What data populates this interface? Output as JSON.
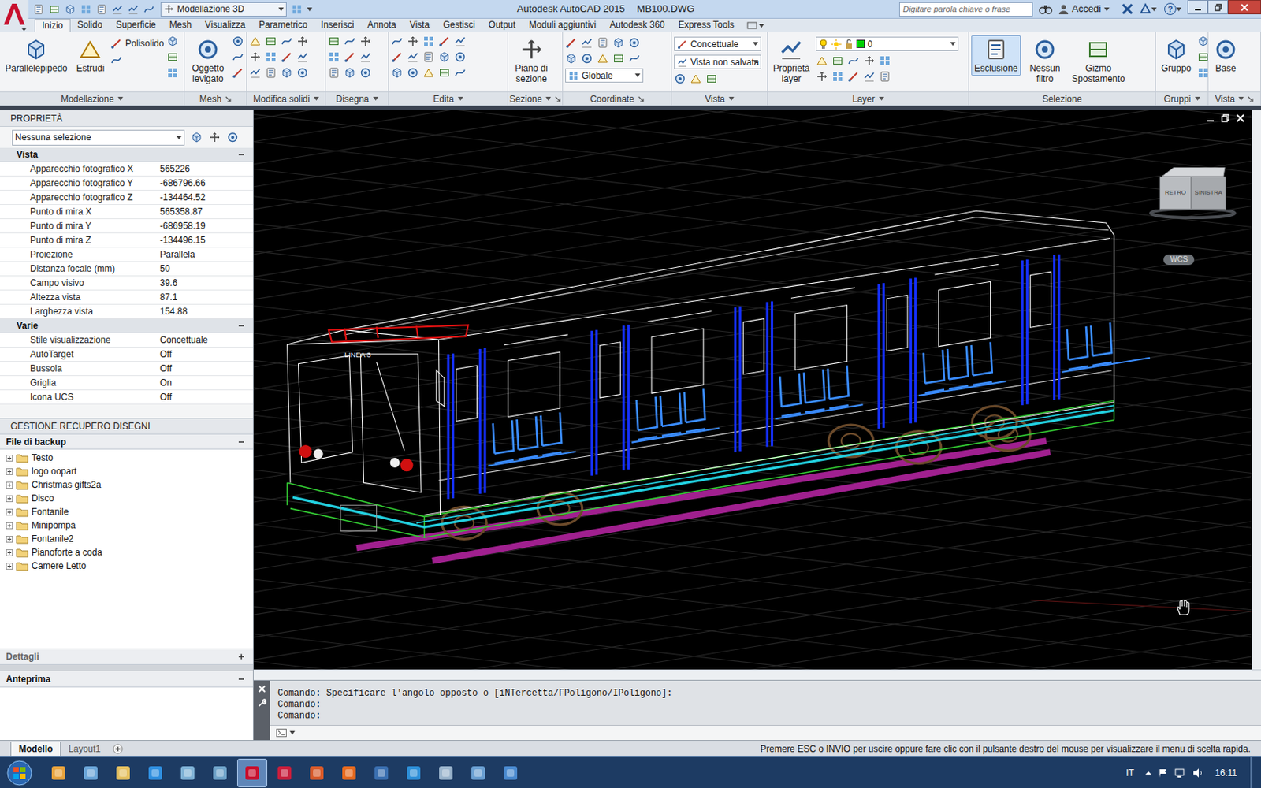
{
  "window": {
    "app": "Autodesk AutoCAD 2015",
    "file": "MB100.DWG"
  },
  "workspace": "Modellazione 3D",
  "search": {
    "placeholder": "Digitare parola chiave o frase"
  },
  "account": "Accedi",
  "help": "?",
  "ribbon_tabs": [
    {
      "label": "Inizio",
      "selected": true
    },
    {
      "label": "Solido",
      "selected": false
    },
    {
      "label": "Superficie",
      "selected": false
    },
    {
      "label": "Mesh",
      "selected": false
    },
    {
      "label": "Visualizza",
      "selected": false
    },
    {
      "label": "Parametrico",
      "selected": false
    },
    {
      "label": "Inserisci",
      "selected": false
    },
    {
      "label": "Annota",
      "selected": false
    },
    {
      "label": "Vista",
      "selected": false
    },
    {
      "label": "Gestisci",
      "selected": false
    },
    {
      "label": "Output",
      "selected": false
    },
    {
      "label": "Moduli aggiuntivi",
      "selected": false
    },
    {
      "label": "Autodesk 360",
      "selected": false
    },
    {
      "label": "Express Tools",
      "selected": false
    }
  ],
  "ribbon_panels": [
    {
      "title": "Modellazione",
      "menu": true,
      "launcher": false,
      "buttons": [
        {
          "label": "Parallelepipedo",
          "selected": false
        },
        {
          "label": "Estrudi",
          "selected": false
        }
      ],
      "tools": [
        {
          "label": "Polisolido"
        }
      ],
      "combos": []
    },
    {
      "title": "Mesh",
      "menu": false,
      "launcher": true,
      "buttons": [
        {
          "label": "Oggetto levigato",
          "selected": false
        }
      ],
      "tools": [],
      "combos": []
    },
    {
      "title": "Modifica solidi",
      "menu": true,
      "launcher": false,
      "buttons": [],
      "tools": [],
      "combos": []
    },
    {
      "title": "Disegna",
      "menu": true,
      "launcher": false,
      "buttons": [],
      "tools": [],
      "combos": []
    },
    {
      "title": "Edita",
      "menu": true,
      "launcher": false,
      "buttons": [],
      "tools": [],
      "combos": []
    },
    {
      "title": "Sezione",
      "menu": true,
      "launcher": true,
      "buttons": [
        {
          "label": "Piano di sezione",
          "selected": false
        }
      ],
      "tools": [],
      "combos": []
    },
    {
      "title": "Coordinate",
      "menu": false,
      "launcher": true,
      "buttons": [],
      "tools": [],
      "combos": [
        {
          "value": "Globale"
        }
      ]
    },
    {
      "title": "Vista",
      "menu": true,
      "launcher": false,
      "buttons": [],
      "tools": [],
      "combos": [
        {
          "value": "Concettuale"
        },
        {
          "value": "Vista non salvata"
        }
      ]
    },
    {
      "title": "Layer",
      "menu": true,
      "launcher": false,
      "buttons": [
        {
          "label": "Proprietà layer",
          "selected": false
        }
      ],
      "tools": [],
      "combos": [
        {
          "value": "0"
        }
      ]
    },
    {
      "title": "Selezione",
      "menu": false,
      "launcher": false,
      "buttons": [
        {
          "label": "Esclusione",
          "selected": true
        },
        {
          "label": "Nessun filtro",
          "selected": false
        },
        {
          "label": "Gizmo Spostamento",
          "selected": false
        }
      ],
      "tools": [],
      "combos": []
    },
    {
      "title": "Gruppi",
      "menu": true,
      "launcher": false,
      "buttons": [
        {
          "label": "Gruppo",
          "selected": false
        }
      ],
      "tools": [],
      "combos": []
    },
    {
      "title": "Vista",
      "menu": true,
      "launcher": true,
      "buttons": [
        {
          "label": "Base",
          "selected": false
        }
      ],
      "tools": [],
      "combos": []
    }
  ],
  "properties": {
    "title": "PROPRIETÀ",
    "selection": "Nessuna selezione",
    "sections": [
      {
        "title": "Vista",
        "expanded": true,
        "rows": [
          {
            "label": "Apparecchio fotografico X",
            "value": "565226"
          },
          {
            "label": "Apparecchio fotografico Y",
            "value": "-686796.66"
          },
          {
            "label": "Apparecchio fotografico Z",
            "value": "-134464.52"
          },
          {
            "label": "Punto di mira X",
            "value": "565358.87"
          },
          {
            "label": "Punto di mira Y",
            "value": "-686958.19"
          },
          {
            "label": "Punto di mira Z",
            "value": "-134496.15"
          },
          {
            "label": "Proiezione",
            "value": "Parallela"
          },
          {
            "label": "Distanza focale (mm)",
            "value": "50"
          },
          {
            "label": "Campo visivo",
            "value": "39.6"
          },
          {
            "label": "Altezza vista",
            "value": "87.1"
          },
          {
            "label": "Larghezza vista",
            "value": "154.88"
          }
        ]
      },
      {
        "title": "Varie",
        "expanded": true,
        "rows": [
          {
            "label": "Stile visualizzazione",
            "value": "Concettuale"
          },
          {
            "label": "AutoTarget",
            "value": "Off"
          },
          {
            "label": "Bussola",
            "value": "Off"
          },
          {
            "label": "Griglia",
            "value": "On"
          },
          {
            "label": "Icona UCS",
            "value": "Off"
          }
        ]
      }
    ]
  },
  "recovery": {
    "title": "GESTIONE RECUPERO DISEGNI",
    "list_title": "File di backup",
    "list_expanded": true,
    "files": [
      {
        "label": "Testo",
        "expanded": false
      },
      {
        "label": "logo oopart",
        "expanded": false
      },
      {
        "label": "Christmas gifts2a",
        "expanded": false
      },
      {
        "label": "Disco",
        "expanded": false
      },
      {
        "label": "Fontanile",
        "expanded": false
      },
      {
        "label": "Minipompa",
        "expanded": false
      },
      {
        "label": "Fontanile2",
        "expanded": false
      },
      {
        "label": "Pianoforte a coda",
        "expanded": false
      },
      {
        "label": "Camere Letto",
        "expanded": false
      }
    ],
    "details": {
      "label": "Dettagli",
      "expanded": false
    },
    "preview": {
      "label": "Anteprima",
      "expanded": true
    }
  },
  "viewport": {
    "drawing_label": "LINEA 3",
    "viewcube": {
      "faces": [
        "RETRO",
        "SINISTRA"
      ]
    },
    "ucs": "WCS"
  },
  "command_line": {
    "history": [
      "Comando: Specificare l'angolo opposto o [iNTercetta/FPoligono/IPoligono]:",
      "Comando:",
      "Comando:"
    ]
  },
  "layout_tabs": [
    {
      "label": "Modello",
      "selected": true
    },
    {
      "label": "Layout1",
      "selected": false
    }
  ],
  "status_bar": {
    "message": "Premere ESC o INVIO per uscire oppure fare clic con il pulsante destro del mouse per visualizzare il menu di scelta rapida."
  },
  "taskbar": {
    "apps": [
      {
        "active": false
      },
      {
        "active": false
      },
      {
        "active": false
      },
      {
        "active": false
      },
      {
        "active": false
      },
      {
        "active": false
      },
      {
        "active": true
      },
      {
        "active": false
      },
      {
        "active": false
      },
      {
        "active": false
      },
      {
        "active": false
      },
      {
        "active": false
      },
      {
        "active": false
      },
      {
        "active": false
      },
      {
        "active": false
      }
    ],
    "language": "IT",
    "time": "16:11"
  }
}
